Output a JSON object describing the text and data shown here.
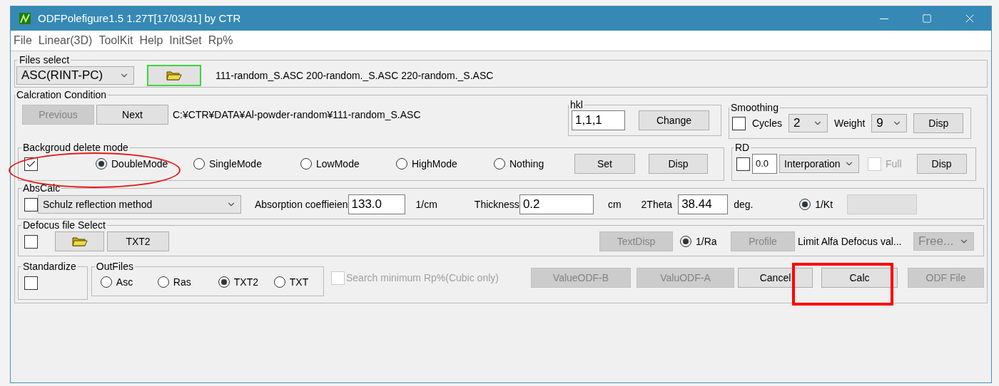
{
  "window": {
    "title": "ODFPolefigure1.5 1.27T[17/03/31] by CTR"
  },
  "menu": [
    "File",
    "Linear(3D)",
    "ToolKit",
    "Help",
    "InitSet",
    "Rp%"
  ],
  "files_select": {
    "label": "Files select",
    "format": "ASC(RINT-PC)",
    "files": "111-random_S.ASC 200-random._S.ASC 220-random._S.ASC"
  },
  "calc_condition": {
    "label": "Calcration Condition",
    "previous": {
      "label": "Previous",
      "disabled": true
    },
    "next": {
      "label": "Next",
      "disabled": false
    },
    "path": "C:¥CTR¥DATA¥Al-powder-random¥111-random_S.ASC",
    "hkl": {
      "label": "hkl",
      "value": "1,1,1",
      "button": "Change"
    },
    "smoothing": {
      "label": "Smoothing",
      "checked": false,
      "cycles_label": "Cycles",
      "cycles": "2",
      "weight_label": "Weight",
      "weight": "9",
      "button": "Disp"
    }
  },
  "background": {
    "label": "Backgroud delete mode",
    "checked": true,
    "modes": [
      {
        "label": "DoubleMode",
        "selected": true
      },
      {
        "label": "SingleMode",
        "selected": false
      },
      {
        "label": "LowMode",
        "selected": false
      },
      {
        "label": "HighMode",
        "selected": false
      },
      {
        "label": "Nothing",
        "selected": false
      }
    ],
    "set": "Set",
    "disp": "Disp"
  },
  "rd": {
    "label": "RD",
    "checked": false,
    "value": "0.0",
    "mode": "Interporation",
    "full_label": "Full",
    "full_checked": false,
    "full_disabled": true,
    "button": "Disp"
  },
  "abscalc": {
    "label": "AbsCalc",
    "checked": false,
    "method": "Schulz reflection method",
    "absorption_label": "Absorption coeffieien",
    "absorption": "133.0",
    "absorption_unit": "1/cm",
    "thickness_label": "Thickness",
    "thickness": "0.2",
    "thickness_unit": "cm",
    "theta_label": "2Theta",
    "theta": "38.44",
    "theta_unit": "deg.",
    "kt_label": "1/Kt",
    "kt_selected": true
  },
  "defocus": {
    "label": "Defocus file Select",
    "checked": false,
    "txt2": "TXT2",
    "textdisp": {
      "label": "TextDisp",
      "disabled": true
    },
    "ra_label": "1/Ra",
    "ra_selected": true,
    "profile": {
      "label": "Profile",
      "disabled": true
    },
    "limit_label": "Limit Alfa Defocus val...",
    "limit_value": "Free...",
    "limit_disabled": true
  },
  "standardize": {
    "label": "Standardize",
    "checked": false
  },
  "outfiles": {
    "label": "OutFiles",
    "options": [
      {
        "label": "Asc",
        "selected": false
      },
      {
        "label": "Ras",
        "selected": false
      },
      {
        "label": "TXT2",
        "selected": true
      },
      {
        "label": "TXT",
        "selected": false
      }
    ]
  },
  "search_min": {
    "label": "Search minimum Rp%(Cubic only)",
    "checked": false,
    "disabled": true
  },
  "buttons": [
    {
      "label": "ValueODF-B",
      "disabled": true
    },
    {
      "label": "ValuODF-A",
      "disabled": true
    },
    {
      "label": "Cancel",
      "disabled": false
    },
    {
      "label": "Calc",
      "disabled": false
    },
    {
      "label": "ODF File",
      "disabled": true
    }
  ],
  "annotations": [
    {
      "kind": "ellipse"
    },
    {
      "kind": "rect"
    }
  ]
}
